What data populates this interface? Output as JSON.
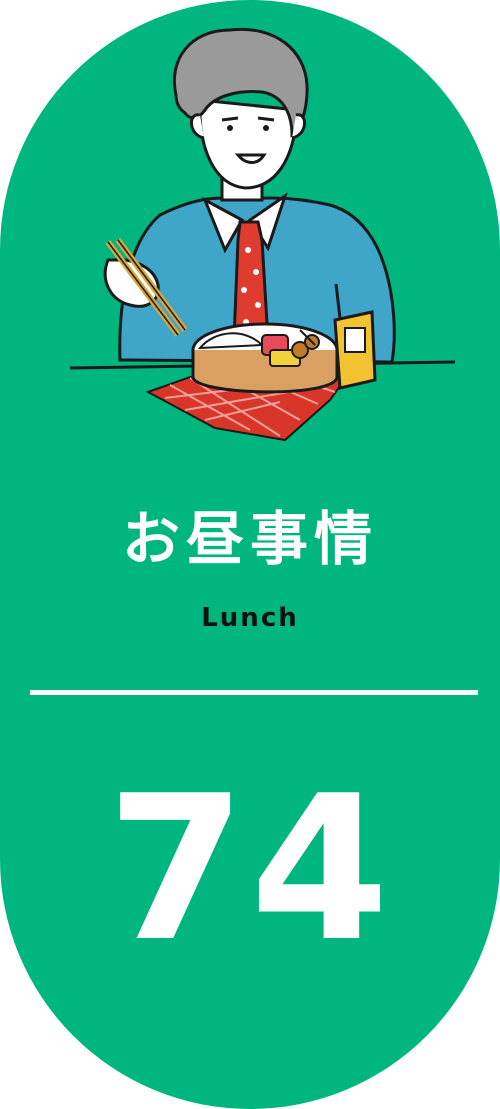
{
  "card": {
    "title": "お昼事情",
    "subtitle": "Lunch",
    "number": "74",
    "colors": {
      "background": "#00b67f",
      "text_light": "#ffffff",
      "text_dark": "#111111"
    }
  },
  "illustration": {
    "icon": "person-eating-bento-illustration"
  }
}
